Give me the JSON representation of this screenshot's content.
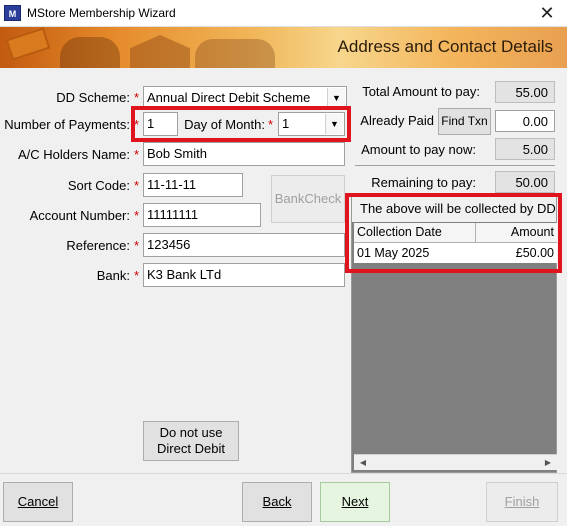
{
  "window": {
    "title": "MStore Membership Wizard",
    "icon_text": "M"
  },
  "banner": {
    "title": "Address and Contact Details"
  },
  "form": {
    "dd_scheme_label": "DD Scheme:",
    "dd_scheme_value": "Annual Direct Debit Scheme",
    "num_payments_label": "Number of Payments:",
    "num_payments_value": "1",
    "day_of_month_label": "Day of Month:",
    "day_of_month_value": "1",
    "holder_label": "A/C Holders Name:",
    "holder_value": "Bob Smith",
    "sort_code_label": "Sort Code:",
    "sort_code_value": "11-11-11",
    "account_label": "Account Number:",
    "account_value": "11111111",
    "reference_label": "Reference:",
    "reference_value": "123456",
    "bank_label": "Bank:",
    "bank_value": "K3 Bank LTd",
    "required_marker": "*",
    "bankcheck_label": "BankCheck",
    "no_dd_line1": "Do not use",
    "no_dd_line2": "Direct Debit"
  },
  "totals": {
    "total_label": "Total Amount to pay:",
    "total_value": "55.00",
    "paid_label": "Already Paid",
    "find_txn_label": "Find Txn",
    "paid_value": "0.00",
    "now_label": "Amount to pay now:",
    "now_value": "5.00",
    "remaining_label": "Remaining to pay:",
    "remaining_value": "50.00"
  },
  "collections": {
    "caption": "The above will be collected by DD:",
    "columns": [
      "Collection Date",
      "Amount"
    ],
    "rows": [
      [
        "01 May 2025",
        "£50.00"
      ]
    ]
  },
  "footer": {
    "cancel": "Cancel",
    "back": "Back",
    "next": "Next",
    "finish": "Finish"
  },
  "colors": {
    "highlight": "#e0141e",
    "next_button": "#e5f5e0"
  },
  "icons": [
    "app-icon",
    "close-icon",
    "chevron-down-icon",
    "scroll-left-icon",
    "scroll-right-icon"
  ]
}
